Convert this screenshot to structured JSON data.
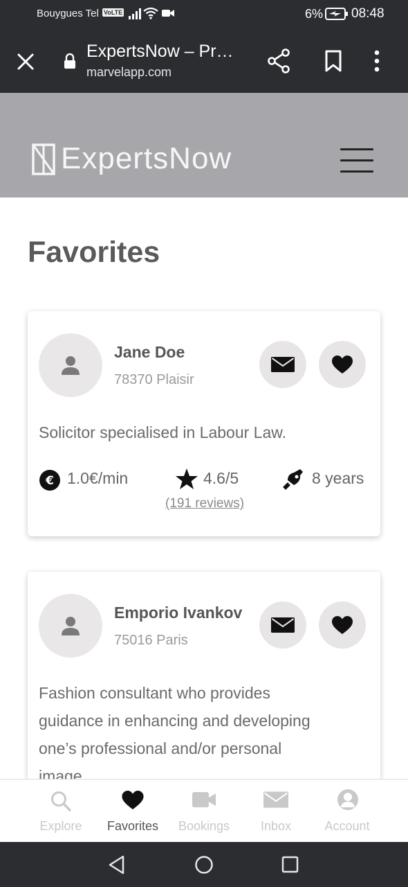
{
  "status_bar": {
    "carrier": "Bouygues Tel",
    "volte": "VoLTE",
    "battery_percent": "6%",
    "time": "08:48",
    "icons": [
      "signal-icon",
      "wifi-icon",
      "video-camera-icon",
      "battery-charging-icon"
    ]
  },
  "browser": {
    "page_title": "ExpertsNow – Pr…",
    "url": "marvelapp.com",
    "icons": [
      "close-icon",
      "lock-icon",
      "share-icon",
      "bookmark-icon",
      "more-vert-icon"
    ]
  },
  "header": {
    "brand": "ExpertsNow",
    "icons": [
      "logo-icon",
      "hamburger-menu-icon"
    ]
  },
  "page": {
    "title": "Favorites"
  },
  "experts": [
    {
      "name": "Jane Doe",
      "location": "78370 Plaisir",
      "description": "Solicitor specialised in Labour Law.",
      "price": "1.0€/min",
      "rating": "4.6/5",
      "reviews": "(191 reviews)",
      "experience": "8 years"
    },
    {
      "name": "Emporio Ivankov",
      "location": "75016 Paris",
      "description_lines": [
        "Fashion consultant who provides",
        "guidance in enhancing and developing",
        "one’s professional and/or personal",
        "image."
      ]
    }
  ],
  "tabs": [
    {
      "label": "Explore",
      "icon": "search-icon",
      "active": false
    },
    {
      "label": "Favorites",
      "icon": "heart-icon",
      "active": true
    },
    {
      "label": "Bookings",
      "icon": "video-camera-icon",
      "active": false
    },
    {
      "label": "Inbox",
      "icon": "mail-icon",
      "active": false
    },
    {
      "label": "Account",
      "icon": "account-icon",
      "active": false
    }
  ],
  "colors": {
    "header_bg": "#a7a7ab",
    "system_bar_bg": "#2b2d31",
    "card_button_bg": "#e7e5e6"
  }
}
